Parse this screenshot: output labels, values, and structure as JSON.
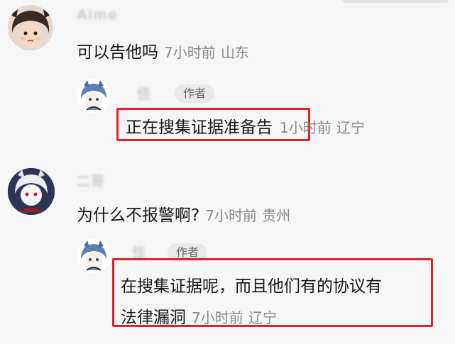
{
  "comments": [
    {
      "username": "Aime",
      "text": "可以告他吗",
      "time": "7小时前",
      "location": "山东",
      "reply": {
        "username": "怪",
        "author_tag": "作者",
        "text": "正在搜集证据准备告",
        "time": "1小时前",
        "location": "辽宁"
      }
    },
    {
      "username": "二哥",
      "text": "为什么不报警啊?",
      "time": "7小时前",
      "location": "贵州",
      "reply": {
        "username": "怪",
        "author_tag": "作者",
        "text_line1": "在搜集证据呢，而且他们有的协议有",
        "text_line2": "法律漏洞",
        "time": "7小时前",
        "location": "辽宁"
      }
    }
  ],
  "highlight_color": "#e3212b"
}
